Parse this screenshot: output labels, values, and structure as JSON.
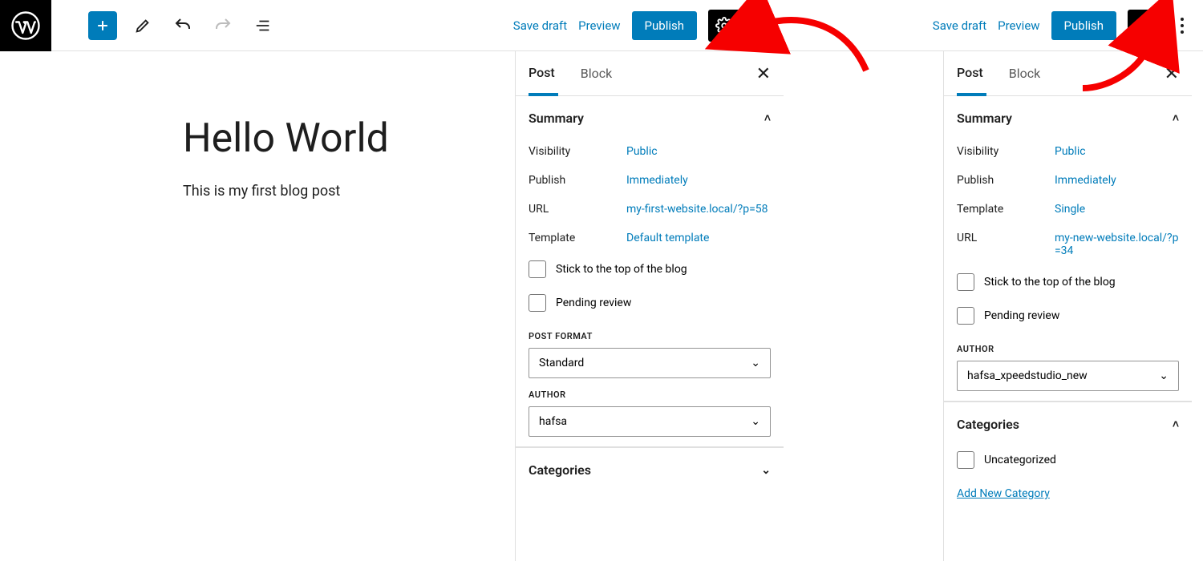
{
  "toolbar": {
    "save_draft": "Save draft",
    "preview": "Preview",
    "publish": "Publish"
  },
  "panel": {
    "tab_post": "Post",
    "tab_block": "Block",
    "summary": "Summary",
    "visibility_label": "Visibility",
    "publish_label": "Publish",
    "url_label": "URL",
    "template_label": "Template",
    "stick": "Stick to the top of the blog",
    "pending": "Pending review",
    "post_format_label": "POST FORMAT",
    "author_label": "AUTHOR",
    "categories_label": "Categories",
    "uncategorized": "Uncategorized",
    "add_category": "Add New Category"
  },
  "left": {
    "post_title": "Hello World",
    "post_body": "This is my first blog post",
    "summary": {
      "visibility": "Public",
      "publish": "Immediately",
      "url": "my-first-website.local/?p=58",
      "template": "Default template"
    },
    "post_format": "Standard",
    "author": "hafsa"
  },
  "right": {
    "summary": {
      "visibility": "Public",
      "publish": "Immediately",
      "template": "Single",
      "url": "my-new-website.local/?p=34"
    },
    "author": "hafsa_xpeedstudio_new"
  }
}
